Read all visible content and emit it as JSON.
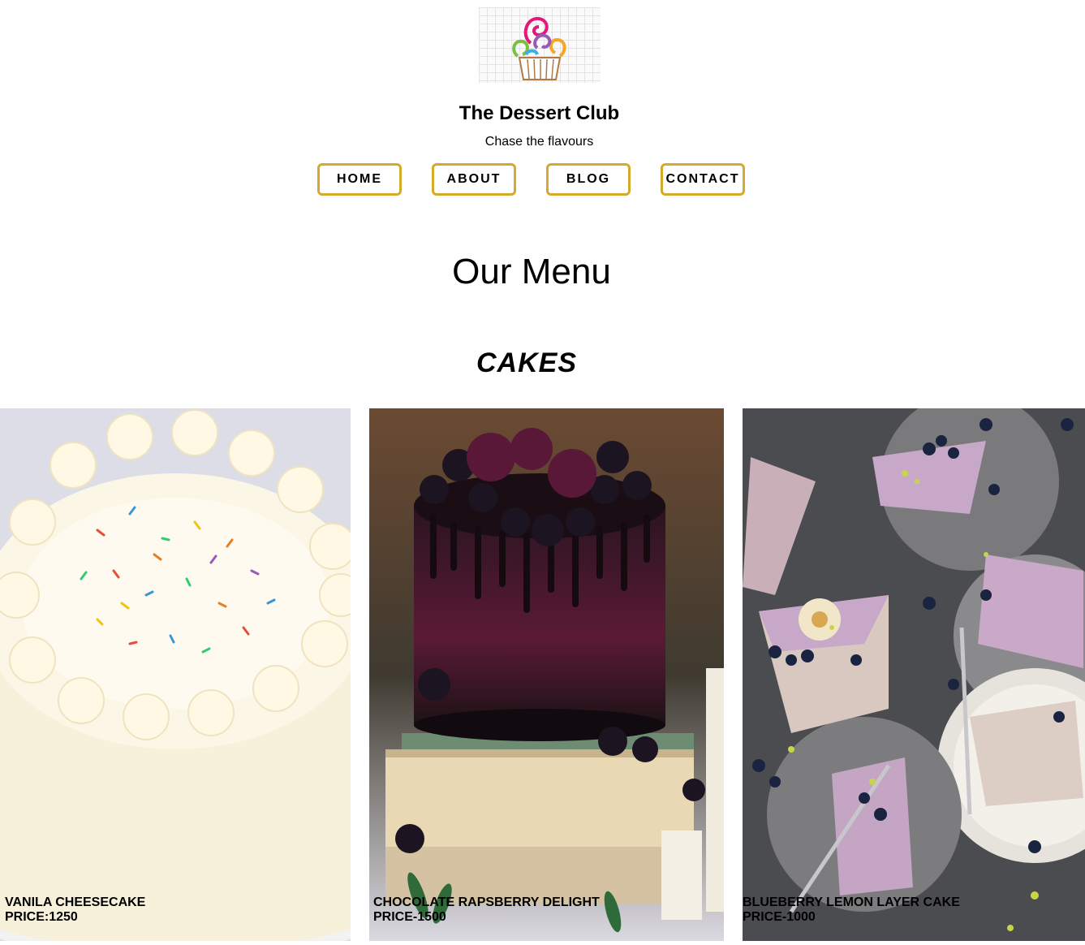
{
  "header": {
    "logo_icon": "cupcake-logo-icon",
    "title": "The Dessert Club",
    "tagline": "Chase the flavours"
  },
  "nav": {
    "items": [
      {
        "label": "HOME"
      },
      {
        "label": "ABOUT"
      },
      {
        "label": "BLOG"
      },
      {
        "label": "CONTACT"
      }
    ],
    "border_color": "#d4a92c"
  },
  "menu": {
    "heading": "Our Menu",
    "section": "CAKES",
    "cards": [
      {
        "name": "VANILA CHEESECAKE",
        "price": "PRICE:1250"
      },
      {
        "name": "CHOCOLATE RAPSBERRY DELIGHT",
        "price": "PRICE-1500"
      },
      {
        "name": "BLUEBERRY LEMON LAYER CAKE",
        "price": "PRICE-1000"
      }
    ]
  }
}
